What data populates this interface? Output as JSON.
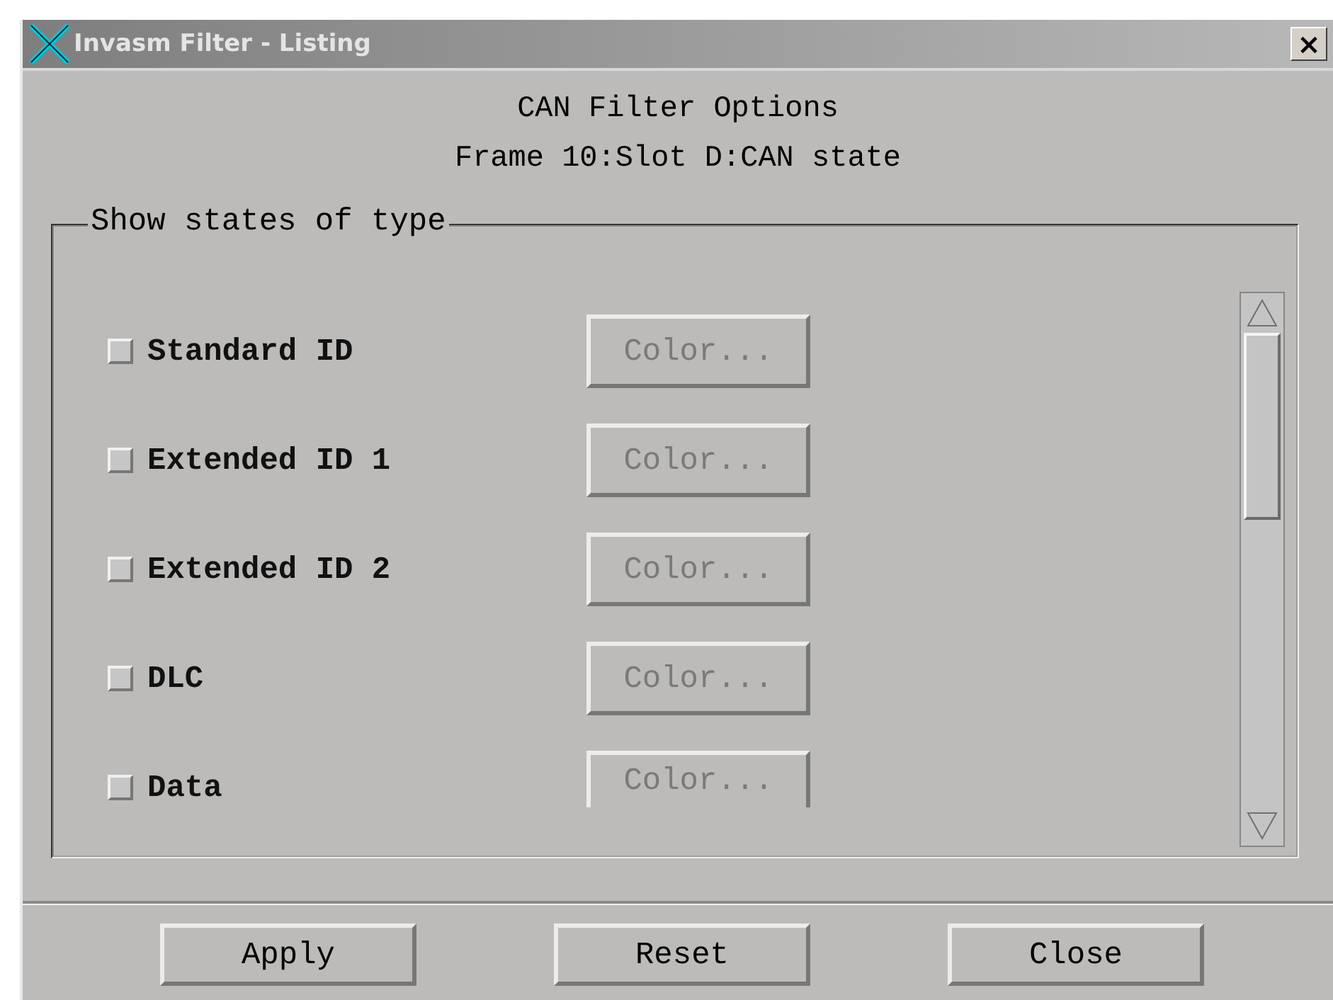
{
  "window": {
    "title": "Invasm Filter - Listing",
    "close": "×"
  },
  "header": {
    "title": "CAN Filter Options",
    "subtitle": "Frame 10:Slot D:CAN state"
  },
  "group": {
    "title": "Show states of type",
    "rows": [
      {
        "label": "Standard ID",
        "checked": false,
        "button": "Color...",
        "disabled": true
      },
      {
        "label": "Extended ID 1",
        "checked": false,
        "button": "Color...",
        "disabled": true
      },
      {
        "label": "Extended ID 2",
        "checked": false,
        "button": "Color...",
        "disabled": true
      },
      {
        "label": "DLC",
        "checked": false,
        "button": "Color...",
        "disabled": true
      },
      {
        "label": "Data",
        "checked": false,
        "button": "Color...",
        "disabled": true
      }
    ]
  },
  "buttons": [
    "Apply",
    "Reset",
    "Close"
  ]
}
